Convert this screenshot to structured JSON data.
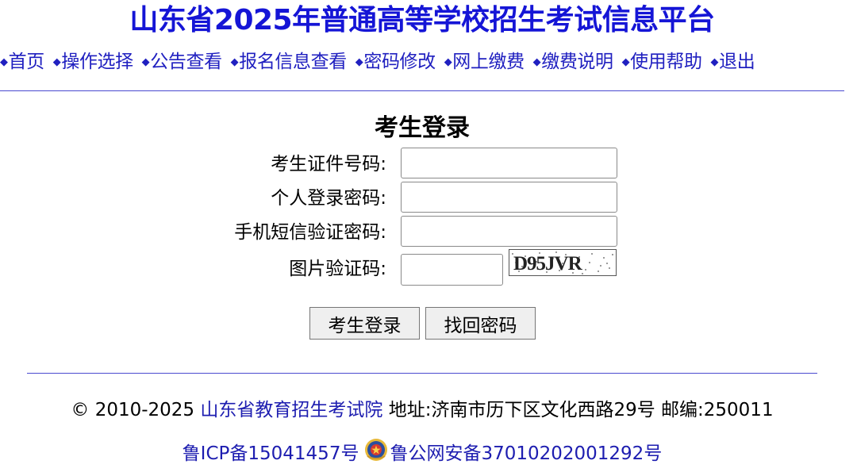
{
  "header": {
    "site_title": "山东省2025年普通高等学校招生考试信息平台"
  },
  "nav": {
    "items": [
      {
        "label": "首页"
      },
      {
        "label": "操作选择"
      },
      {
        "label": "公告查看"
      },
      {
        "label": "报名信息查看"
      },
      {
        "label": "密码修改"
      },
      {
        "label": "网上缴费"
      },
      {
        "label": "缴费说明"
      },
      {
        "label": "使用帮助"
      },
      {
        "label": "退出"
      }
    ],
    "bullet": "◆"
  },
  "login": {
    "title": "考生登录",
    "id_label": "考生证件号码:",
    "id_value": "",
    "password_label": "个人登录密码:",
    "password_value": "",
    "sms_label": "手机短信验证密码:",
    "sms_value": "",
    "captcha_label": "图片验证码:",
    "captcha_value": "",
    "captcha_text": "D95JVR",
    "login_button": "考生登录",
    "recover_button": "找回密码"
  },
  "footer": {
    "copyright": "© 2010-2025",
    "org_link": "山东省教育招生考试院",
    "address": "地址:济南市历下区文化西路29号 邮编:250011",
    "icp_link": "鲁ICP备15041457号",
    "police_link": "鲁公网安备37010202001292号"
  },
  "colors": {
    "title": "#1515d6",
    "link": "#1d1db0",
    "nav": "#2020c0",
    "rule": "#4a4ad0",
    "text": "#000000"
  }
}
